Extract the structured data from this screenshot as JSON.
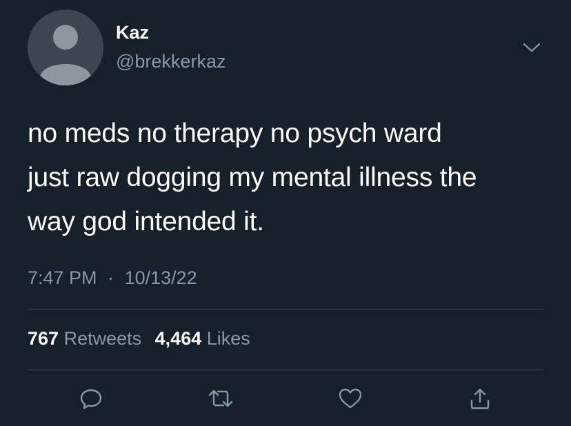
{
  "user": {
    "display_name": "Kaz",
    "handle": "@brekkerkaz",
    "avatar_icon": "default-avatar-icon"
  },
  "tweet": {
    "lines": [
      "no meds no therapy no psych ward",
      "just raw dogging my mental illness the",
      "way god intended it."
    ],
    "time": "7:47 PM",
    "separator": "·",
    "date": "10/13/22"
  },
  "stats": {
    "retweets_count": "767",
    "retweets_label": "Retweets",
    "likes_count": "4,464",
    "likes_label": "Likes"
  },
  "actions": [
    "reply-icon",
    "retweet-icon",
    "like-icon",
    "share-icon"
  ],
  "colors": {
    "background": "#15202b",
    "secondary_text": "#8899a6",
    "divider": "#38444d",
    "avatar_bg": "#38444d",
    "avatar_fg": "#8899a6"
  }
}
